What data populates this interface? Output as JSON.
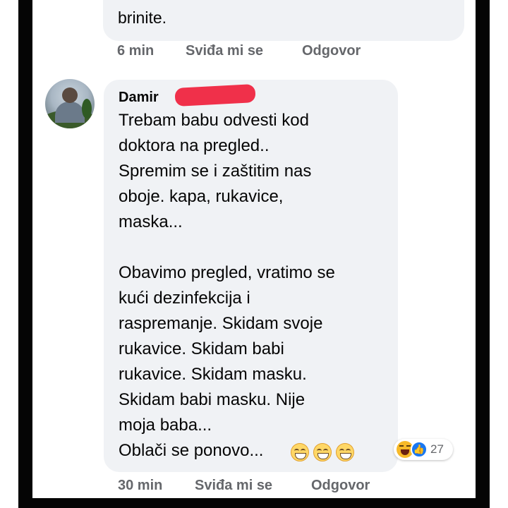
{
  "previous_comment": {
    "text_tail": "brinite.",
    "time": "6 min",
    "like_label": "Sviđa mi se",
    "reply_label": "Odgovor"
  },
  "comment": {
    "author": "Damir",
    "lines": [
      "Trebam babu odvesti kod",
      "doktora na pregled..",
      "Spremim se i zaštitim nas",
      "oboje. kapa, rukavice,",
      "maska...",
      "Obavimo pregled, vratimo se",
      "kući dezinfekcija i",
      "raspremanje. Skidam svoje",
      "rukavice. Skidam babi",
      "rukavice. Skidam masku.",
      "Skidam babi masku. Nije",
      "moja baba...",
      "Oblači se ponovo..."
    ],
    "trailing_emojis": [
      "grinning-squinting-face",
      "grinning-squinting-face",
      "grinning-squinting-face"
    ],
    "reactions": {
      "types": [
        "haha",
        "like"
      ],
      "count": "27"
    },
    "time": "30 min",
    "like_label": "Sviđa mi se",
    "reply_label": "Odgovor"
  },
  "colors": {
    "bubble": "#f0f2f5",
    "meta_text": "#65676b",
    "like_blue": "#1877f2",
    "redaction": "#f0304a",
    "frame": "#050505"
  }
}
